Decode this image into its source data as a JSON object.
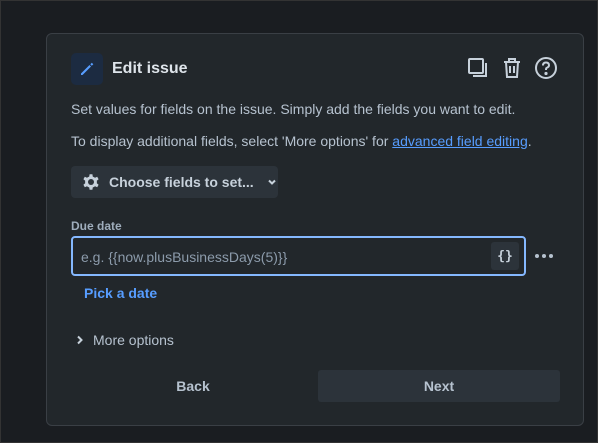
{
  "header": {
    "title": "Edit issue",
    "accent_color": "#579dff"
  },
  "description": {
    "line1": "Set values for fields on the issue. Simply add the fields you want to edit.",
    "line2_prefix": "To display additional fields, select 'More options' for ",
    "line2_link": "advanced field editing",
    "line2_suffix": "."
  },
  "choose_fields": {
    "label": "Choose fields to set..."
  },
  "due_date": {
    "label": "Due date",
    "placeholder": "e.g. {{now.plusBusinessDays(5)}}",
    "value": "",
    "smart_value_label": "{}",
    "pick_date_label": "Pick a date"
  },
  "more_options": {
    "label": "More options"
  },
  "footer": {
    "back_label": "Back",
    "next_label": "Next"
  },
  "icons": {
    "edit": "pencil-icon",
    "duplicate": "copy-icon",
    "delete": "trash-icon",
    "help": "question-circle-icon",
    "settings": "gear-icon",
    "dropdown": "chevron-down-icon",
    "expand": "chevron-right-icon",
    "more": "more-horizontal-icon"
  }
}
